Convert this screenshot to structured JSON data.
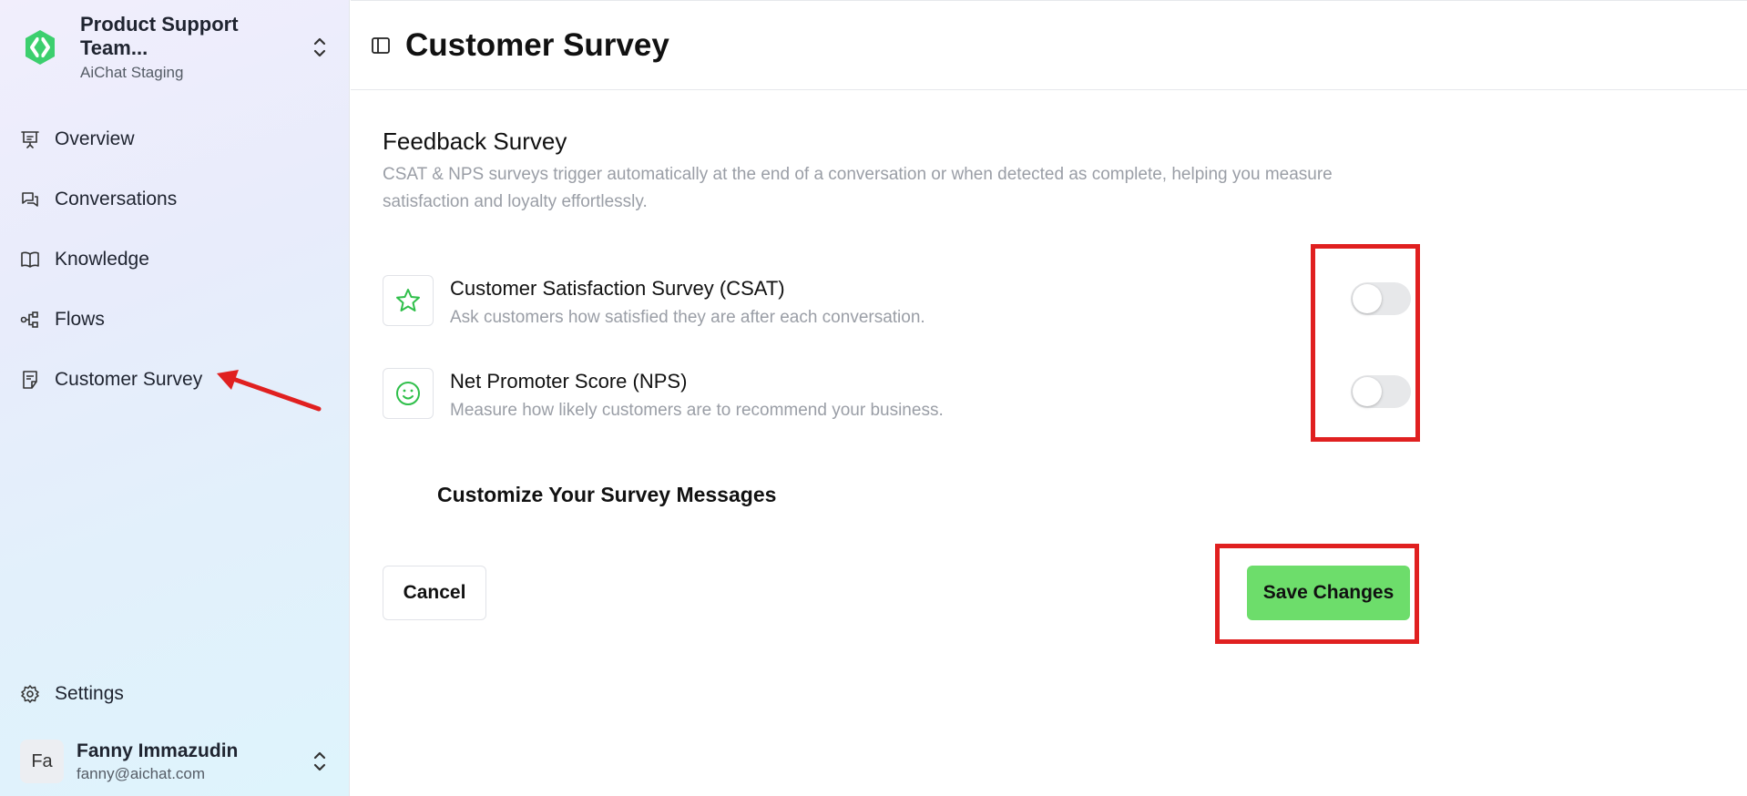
{
  "workspace": {
    "name": "Product Support Team...",
    "subtitle": "AiChat Staging"
  },
  "nav": {
    "items": [
      {
        "label": "Overview",
        "icon": "presentation-icon"
      },
      {
        "label": "Conversations",
        "icon": "chat-icon"
      },
      {
        "label": "Knowledge",
        "icon": "book-icon"
      },
      {
        "label": "Flows",
        "icon": "flow-icon"
      },
      {
        "label": "Customer Survey",
        "icon": "document-icon"
      }
    ],
    "settings_label": "Settings"
  },
  "user": {
    "initials": "Fa",
    "name": "Fanny Immazudin",
    "email": "fanny@aichat.com"
  },
  "header": {
    "title": "Customer Survey"
  },
  "feedback": {
    "title": "Feedback Survey",
    "description": "CSAT & NPS surveys trigger automatically at the end of a conversation or when detected as complete, helping you measure satisfaction and loyalty effortlessly.",
    "options": [
      {
        "title": "Customer Satisfaction Survey (CSAT)",
        "description": "Ask customers how satisfied they are after each conversation.",
        "enabled": false,
        "icon": "star-icon"
      },
      {
        "title": "Net Promoter Score (NPS)",
        "description": "Measure how likely customers are to recommend your business.",
        "enabled": false,
        "icon": "smile-icon"
      }
    ]
  },
  "customize_title": "Customize Your Survey Messages",
  "actions": {
    "cancel": "Cancel",
    "save": "Save Changes"
  },
  "colors": {
    "accent": "#6ddd6b",
    "highlight": "#e02020",
    "logo": "#3ccf6e"
  }
}
